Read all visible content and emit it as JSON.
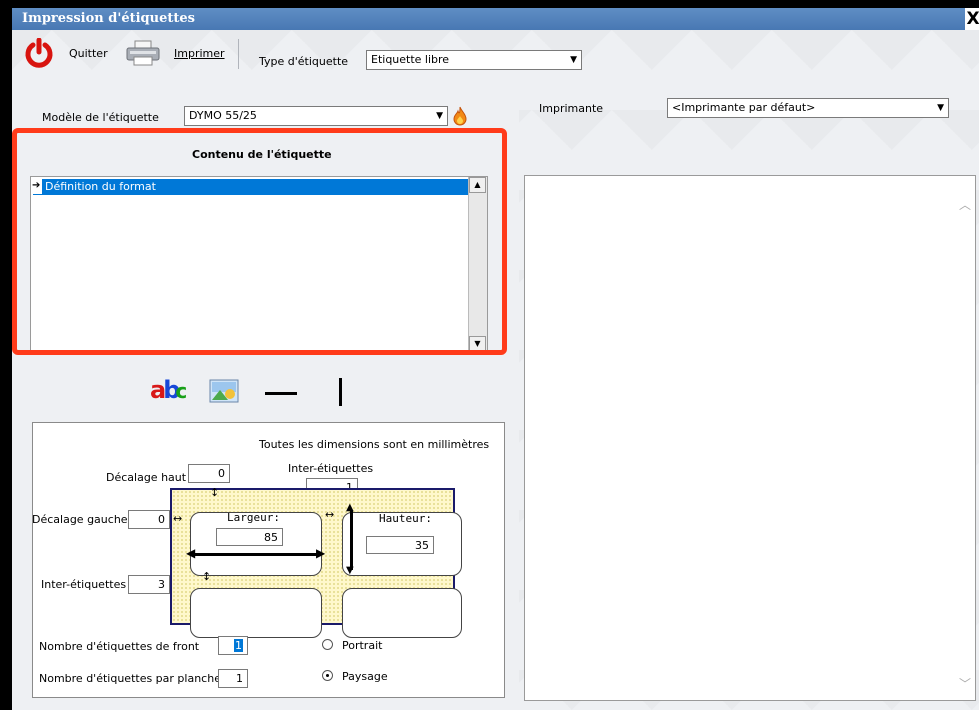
{
  "window": {
    "title": "Impression d'étiquettes",
    "close_glyph": "X"
  },
  "toolbar": {
    "quit_label": "Quitter",
    "print_label": "Imprimer",
    "type_label": "Type d'étiquette",
    "type_value": "Etiquette libre"
  },
  "model": {
    "label": "Modèle de l'étiquette",
    "value": "DYMO 55/25"
  },
  "printer": {
    "label": "Imprimante",
    "value": "<Imprimante par défaut>"
  },
  "content": {
    "title": "Contenu de l'étiquette",
    "items": [
      {
        "label": "Définition du format",
        "selected": true
      }
    ]
  },
  "tools": [
    "text-abc-icon",
    "image-icon",
    "horizontal-line-icon",
    "vertical-line-icon"
  ],
  "dimensions": {
    "note": "Toutes les dimensions sont en millimètres",
    "offset_top_label": "Décalage haut",
    "offset_top": "0",
    "between_top_label": "Inter-étiquettes",
    "between_top": "1",
    "offset_left_label": "Décalage gauche",
    "offset_left": "0",
    "width_label": "Largeur:",
    "width": "85",
    "height_label": "Hauteur:",
    "height": "35",
    "between_left_label": "Inter-étiquettes",
    "between_left": "3",
    "front_count_label": "Nombre d'étiquettes de front",
    "front_count": "1",
    "sheet_count_label": "Nombre d'étiquettes par planche",
    "sheet_count": "1",
    "portrait_label": "Portrait",
    "landscape_label": "Paysage",
    "orientation_selected": "Paysage"
  },
  "colors": {
    "highlight_box": "#ff3b1a",
    "selection": "#0078d7",
    "title_bar": "#4f7fba"
  }
}
